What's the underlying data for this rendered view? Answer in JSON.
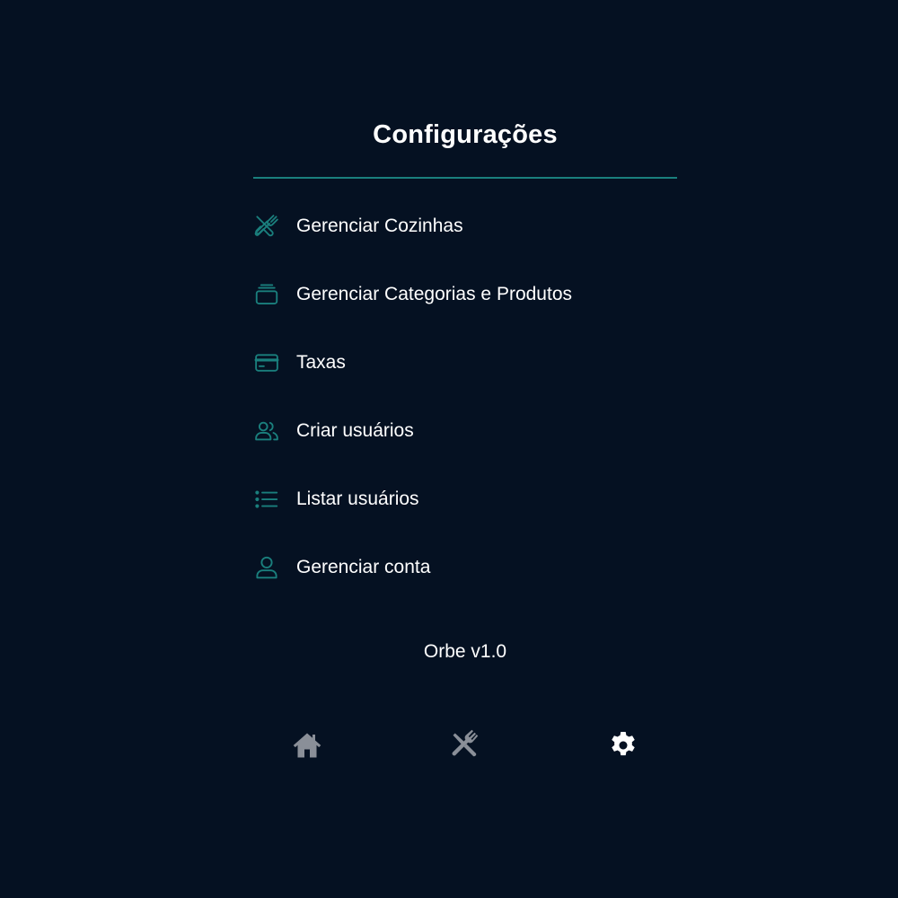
{
  "page": {
    "title": "Configurações",
    "version": "Orbe v1.0"
  },
  "colors": {
    "background": "#051122",
    "accent": "#1a7f7d",
    "text": "#ffffff",
    "nav_inactive": "#8a8f98",
    "nav_active": "#ffffff"
  },
  "menu": [
    {
      "label": "Gerenciar Cozinhas",
      "icon": "utensils-icon"
    },
    {
      "label": "Gerenciar Categorias e Produtos",
      "icon": "stack-icon"
    },
    {
      "label": "Taxas",
      "icon": "credit-card-icon"
    },
    {
      "label": "Criar usuários",
      "icon": "users-icon"
    },
    {
      "label": "Listar usuários",
      "icon": "list-icon"
    },
    {
      "label": "Gerenciar conta",
      "icon": "user-icon"
    }
  ],
  "bottom_nav": [
    {
      "name": "home",
      "icon": "home-icon",
      "active": false
    },
    {
      "name": "kitchen",
      "icon": "utensils-icon",
      "active": false
    },
    {
      "name": "settings",
      "icon": "gear-icon",
      "active": true
    }
  ]
}
